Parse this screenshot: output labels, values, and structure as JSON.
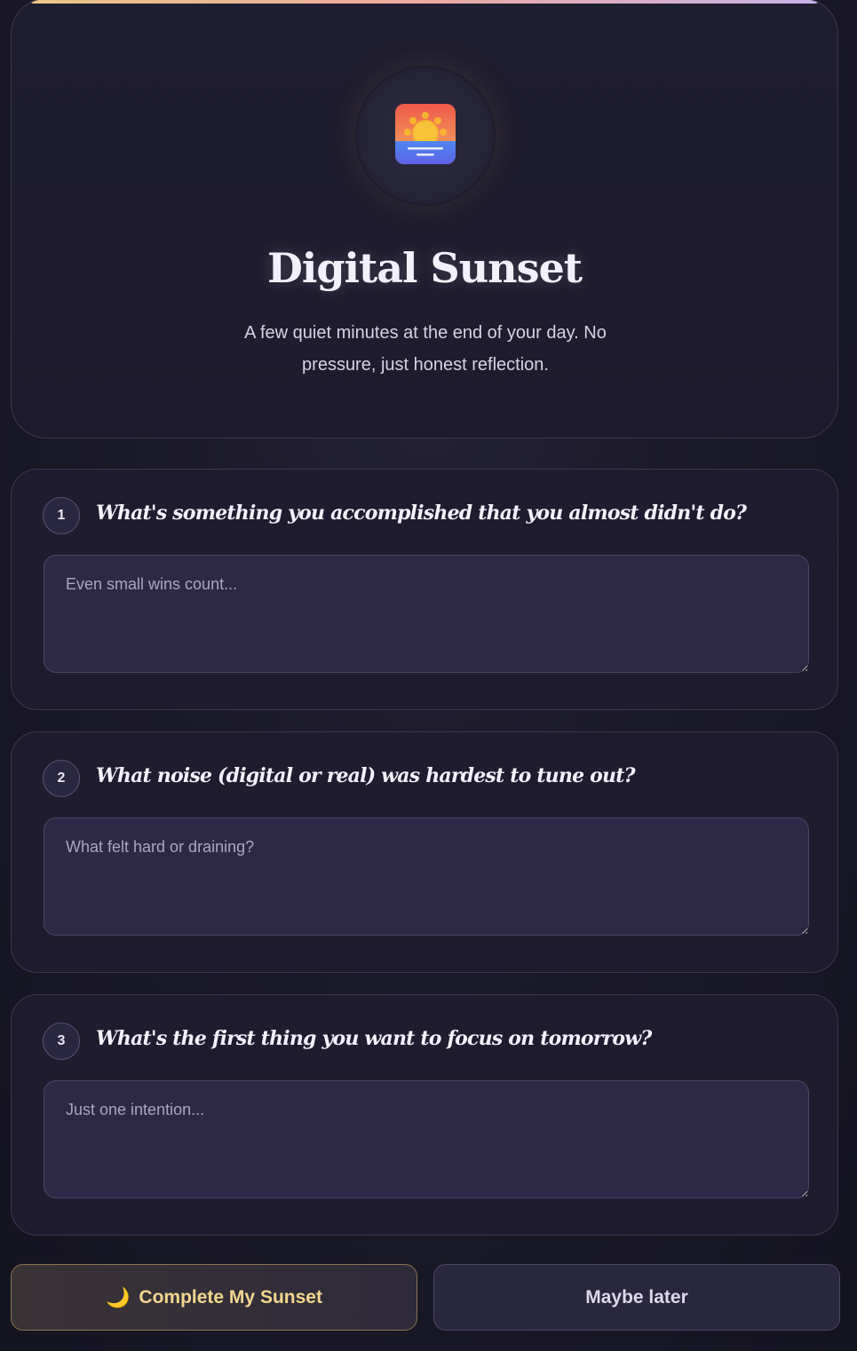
{
  "app": {
    "title": "Digital Sunset",
    "subtitle": "A few quiet minutes at the end of your day. No pressure, just honest reflection.",
    "icon": "sunset-icon"
  },
  "questions": [
    {
      "number": "1",
      "text": "What's something you accomplished that you almost didn't do?",
      "placeholder": "Even small wins count...",
      "value": ""
    },
    {
      "number": "2",
      "text": "What noise (digital or real) was hardest to tune out?",
      "placeholder": "What felt hard or draining?",
      "value": ""
    },
    {
      "number": "3",
      "text": "What's the first thing you want to focus on tomorrow?",
      "placeholder": "Just one intention...",
      "value": ""
    }
  ],
  "actions": {
    "complete_icon": "🌙",
    "complete_label": "Complete My Sunset",
    "later_label": "Maybe later"
  },
  "colors": {
    "accent": "#f4d68e",
    "background": "#1b1a2a",
    "card": "#1e1c2e",
    "input": "#2c2846"
  }
}
